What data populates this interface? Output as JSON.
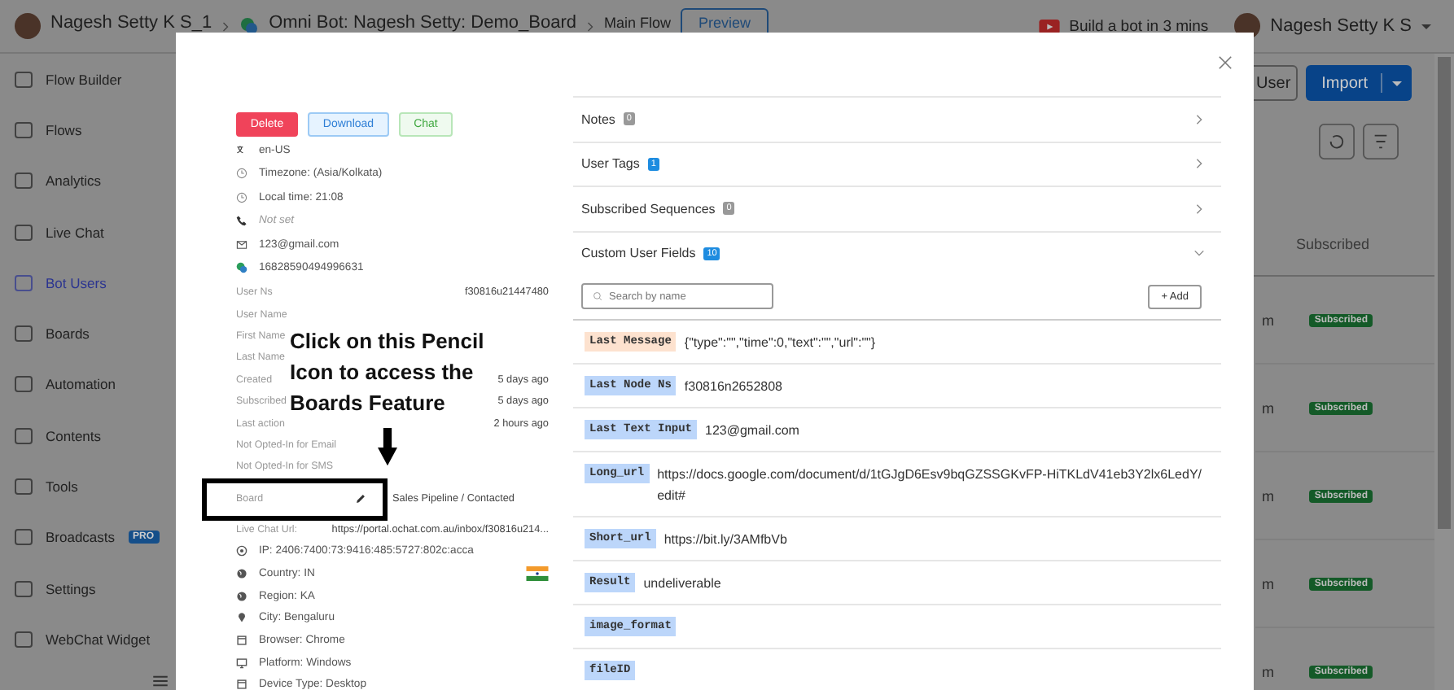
{
  "top_bar": {
    "workspace": "Nagesh Setty K S_1",
    "bot": "Omni Bot: Nagesh Setty: Demo_Board",
    "flow": "Main Flow",
    "preview_button": "Preview",
    "tutorial_link": "Build a bot in 3 mins",
    "account": "Nagesh Setty K S"
  },
  "sidebar": {
    "items": [
      {
        "label": "Flow Builder",
        "selected": false
      },
      {
        "label": "Flows",
        "selected": false
      },
      {
        "label": "Analytics",
        "selected": false
      },
      {
        "label": "Live Chat",
        "selected": false
      },
      {
        "label": "Bot Users",
        "selected": true
      },
      {
        "label": "Boards",
        "selected": false
      },
      {
        "label": "Automation",
        "selected": false
      },
      {
        "label": "Contents",
        "selected": false
      },
      {
        "label": "Tools",
        "selected": false
      },
      {
        "label": "Broadcasts",
        "selected": false,
        "badge": "PRO"
      },
      {
        "label": "Settings",
        "selected": false
      },
      {
        "label": "WebChat Widget",
        "selected": false
      }
    ]
  },
  "background_page": {
    "user_button": "User",
    "import_button": "Import",
    "column_header": "Subscribed",
    "rows": [
      {
        "column_1": "m",
        "status": "Subscribed"
      },
      {
        "column_1": "m",
        "status": "Subscribed"
      },
      {
        "column_1": "m",
        "status": "Subscribed"
      },
      {
        "column_1": "m",
        "status": "Subscribed"
      },
      {
        "column_1": "m",
        "status": "Subscribed"
      }
    ]
  },
  "user_panel": {
    "buttons": {
      "delete": "Delete",
      "download": "Download",
      "chat": "Chat"
    },
    "contact": [
      {
        "text": "en-US",
        "not_set": false
      },
      {
        "text": "Timezone: (Asia/Kolkata)",
        "not_set": false
      },
      {
        "text": "Local time: 21:08",
        "not_set": false
      },
      {
        "text": "Not set",
        "not_set": true
      },
      {
        "text": "123@gmail.com",
        "not_set": false
      },
      {
        "text": "16828590494996631",
        "not_set": false
      }
    ],
    "fields": [
      {
        "label": "User Ns",
        "value": "f30816u21447480",
        "editable": false
      },
      {
        "label": "User Name",
        "editable": false
      },
      {
        "label": "First Name",
        "editable": false
      },
      {
        "label": "Last Name",
        "editable": false
      },
      {
        "label": "Created",
        "value": "5 days ago",
        "editable": false
      },
      {
        "label": "Subscribed",
        "value": "5 days ago",
        "editable": false
      },
      {
        "label": "Last action",
        "value": "2 hours ago",
        "editable": false
      },
      {
        "label": "Not Opted-In for Email",
        "editable": false
      },
      {
        "label": "Not Opted-In for SMS",
        "editable": false
      },
      {
        "label": "Board",
        "value": "Sales Pipeline / Contacted",
        "editable": true
      },
      {
        "label": "Live Chat Url:",
        "value": "https://portal.ochat.com.au/inbox/f30816u214...",
        "editable": false
      }
    ],
    "location": [
      {
        "text": "IP: 2406:7400:73:9416:485:5727:802c:acca",
        "flag": false
      },
      {
        "text": "Country: IN",
        "flag": true
      },
      {
        "text": "Region: KA",
        "flag": false
      },
      {
        "text": "City: Bengaluru",
        "flag": false
      },
      {
        "text": "Browser: Chrome",
        "flag": false
      },
      {
        "text": "Platform: Windows",
        "flag": false
      },
      {
        "text": "Device Type: Desktop",
        "flag": false
      }
    ]
  },
  "sections": [
    {
      "title": "Notes",
      "count": "0",
      "expanded": false
    },
    {
      "title": "User Tags",
      "count": "1",
      "expanded": false
    },
    {
      "title": "Subscribed Sequences",
      "count": "0",
      "expanded": false
    },
    {
      "title": "Custom User Fields",
      "count": "10",
      "expanded": true
    }
  ],
  "custom_fields": {
    "search": {
      "placeholder": "Search by name"
    },
    "add_button": "+ Add",
    "items": [
      {
        "kind": "json",
        "name": "Last Message",
        "value": "{\"type\":\"\",\"time\":0,\"text\":\"\",\"url\":\"\"}"
      },
      {
        "kind": "text",
        "name": "Last Node Ns",
        "value": "f30816n2652808"
      },
      {
        "kind": "text",
        "name": "Last Text Input",
        "value": "123@gmail.com"
      },
      {
        "kind": "text",
        "name": "Long_url",
        "value": "https://docs.google.com/document/d/1tGJgD6Esv9bqGZSSGKvFP-HiTKLdV41eb3Y2lx6LedY/edit#"
      },
      {
        "kind": "text",
        "name": "Short_url",
        "value": "https://bit.ly/3AMfbVb"
      },
      {
        "kind": "text",
        "name": "Result",
        "value": "undeliverable"
      },
      {
        "kind": "text",
        "name": "image_format"
      },
      {
        "kind": "text",
        "name": "fileID"
      }
    ]
  },
  "annotation": {
    "text": "Click on this Pencil Icon to access the Boards Feature"
  }
}
